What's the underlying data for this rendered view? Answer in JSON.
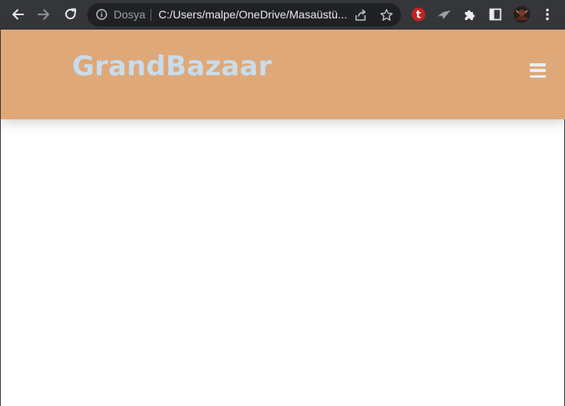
{
  "browser": {
    "address_bar": {
      "security_label": "Dosya",
      "url": "C:/Users/malpe/OneDrive/Masaüstü..."
    },
    "extensions": [
      {
        "name": "t-extension-icon",
        "letter": "t",
        "color": "#c5221f"
      },
      {
        "name": "airplane-extension-icon"
      },
      {
        "name": "puzzle-extensions-icon"
      },
      {
        "name": "side-panel-icon"
      },
      {
        "name": "profile-avatar"
      },
      {
        "name": "kebab-menu-icon"
      }
    ]
  },
  "site": {
    "logo": "GrandBazaar",
    "header_color": "#dfa878",
    "logo_color": "#c8dcec"
  }
}
